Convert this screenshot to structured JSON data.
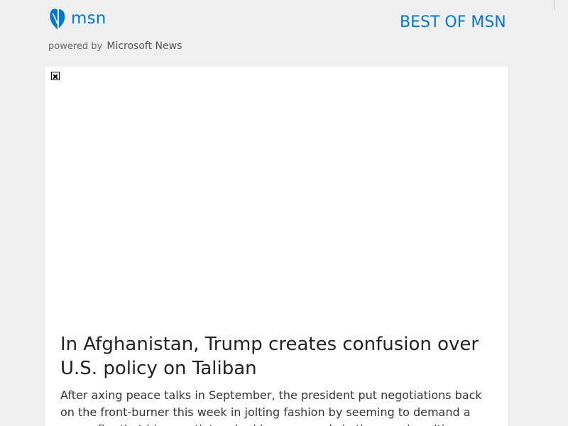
{
  "header": {
    "logo_text": "msn",
    "powered_by": "powered by",
    "brand": "Microsoft News",
    "best_of": "BEST OF MSN",
    "logo_icon": "butterfly-icon"
  },
  "article": {
    "image_icon": "broken-image-icon",
    "headline": "In Afghanistan, Trump creates confusion over U.S. policy on Taliban",
    "summary": "After axing peace talks in September, the president put negotiations back on the front-burner this week in jolting fashion by seeming to demand a cease-fire that his negotiators had been quarrels in the... and position..."
  },
  "colors": {
    "background": "#efefef",
    "brand_blue": "#0078d4",
    "card": "#ffffff",
    "headline": "#222222"
  }
}
